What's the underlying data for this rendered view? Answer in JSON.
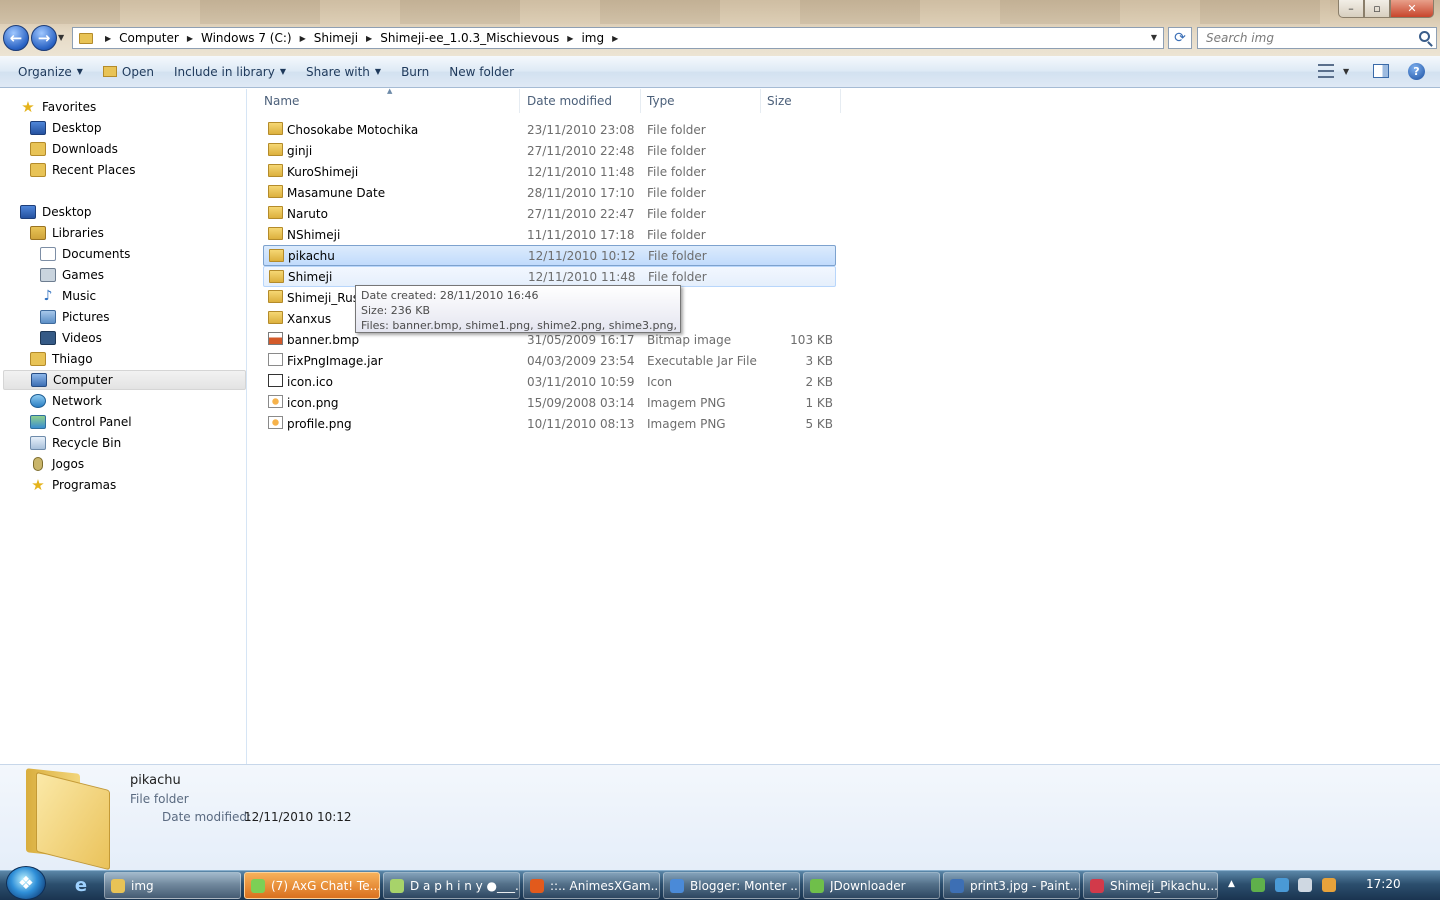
{
  "window": {
    "title": "img",
    "minimize": "–",
    "maximize": "▫",
    "close": "✕"
  },
  "nav": {
    "back": "←",
    "forward": "→"
  },
  "address": {
    "crumbs": [
      "Computer",
      "Windows 7 (C:)",
      "Shimeji",
      "Shimeji-ee_1.0.3_Mischievous",
      "img"
    ]
  },
  "search": {
    "placeholder": "Search img"
  },
  "toolbar": {
    "organize": "Organize",
    "open": "Open",
    "include_in_library": "Include in library",
    "share_with": "Share with",
    "burn": "Burn",
    "new_folder": "New folder",
    "help": "?"
  },
  "sidebar": {
    "favorites": "Favorites",
    "desktop_fav": "Desktop",
    "downloads": "Downloads",
    "recent_places": "Recent Places",
    "desktop": "Desktop",
    "libraries": "Libraries",
    "documents": "Documents",
    "games": "Games",
    "music": "Music",
    "pictures": "Pictures",
    "videos": "Videos",
    "user": "Thiago",
    "computer": "Computer",
    "network": "Network",
    "control_panel": "Control Panel",
    "recycle_bin": "Recycle Bin",
    "jogos": "Jogos",
    "programas": "Programas"
  },
  "columns": {
    "name": "Name",
    "date_modified": "Date modified",
    "type": "Type",
    "size": "Size"
  },
  "files": [
    {
      "name": "Chosokabe Motochika",
      "date": "23/11/2010 23:08",
      "type": "File folder",
      "size": "",
      "icon": "folder"
    },
    {
      "name": "ginji",
      "date": "27/11/2010 22:48",
      "type": "File folder",
      "size": "",
      "icon": "folder"
    },
    {
      "name": "KuroShimeji",
      "date": "12/11/2010 11:48",
      "type": "File folder",
      "size": "",
      "icon": "folder"
    },
    {
      "name": "Masamune Date",
      "date": "28/11/2010 17:10",
      "type": "File folder",
      "size": "",
      "icon": "folder"
    },
    {
      "name": "Naruto",
      "date": "27/11/2010 22:47",
      "type": "File folder",
      "size": "",
      "icon": "folder"
    },
    {
      "name": "NShimeji",
      "date": "11/11/2010 17:18",
      "type": "File folder",
      "size": "",
      "icon": "folder"
    },
    {
      "name": "pikachu",
      "date": "12/11/2010 10:12",
      "type": "File folder",
      "size": "",
      "icon": "folder"
    },
    {
      "name": "Shimeji",
      "date": "12/11/2010 11:48",
      "type": "File folder",
      "size": "",
      "icon": "folder"
    },
    {
      "name": "Shimeji_Russ",
      "date": "",
      "type": "lder",
      "size": "",
      "icon": "folder"
    },
    {
      "name": "Xanxus",
      "date": "",
      "type": "lder",
      "size": "",
      "icon": "folder"
    },
    {
      "name": "banner.bmp",
      "date": "31/05/2009 16:17",
      "type": "Bitmap image",
      "size": "103 KB",
      "icon": "bmp"
    },
    {
      "name": "FixPngImage.jar",
      "date": "04/03/2009 23:54",
      "type": "Executable Jar File",
      "size": "3 KB",
      "icon": "jar"
    },
    {
      "name": "icon.ico",
      "date": "03/11/2010 10:59",
      "type": "Icon",
      "size": "2 KB",
      "icon": "ico"
    },
    {
      "name": "icon.png",
      "date": "15/09/2008 03:14",
      "type": "Imagem PNG",
      "size": "1 KB",
      "icon": "png"
    },
    {
      "name": "profile.png",
      "date": "10/11/2010 08:13",
      "type": "Imagem PNG",
      "size": "5 KB",
      "icon": "png"
    }
  ],
  "tooltip": {
    "created": "Date created: 28/11/2010 16:46",
    "size": "Size: 236 KB",
    "files": "Files: banner.bmp, shime1.png, shime2.png, shime3.png, ..."
  },
  "details": {
    "name": "pikachu",
    "type": "File folder",
    "date_label": "Date modified:",
    "date_value": "12/11/2010 10:12"
  },
  "taskbar": {
    "start": "❖",
    "ie": "e",
    "items": [
      {
        "label": "img"
      },
      {
        "label": "(7) AxG Chat! Te..."
      },
      {
        "label": "D a p h i n y ●___..."
      },
      {
        "label": "::.. AnimesXGam..."
      },
      {
        "label": "Blogger: Monter ..."
      },
      {
        "label": "JDownloader"
      },
      {
        "label": "print3.jpg - Paint..."
      },
      {
        "label": "Shimeji_Pikachu...."
      }
    ],
    "tray_up": "▲",
    "clock": "17:20"
  }
}
